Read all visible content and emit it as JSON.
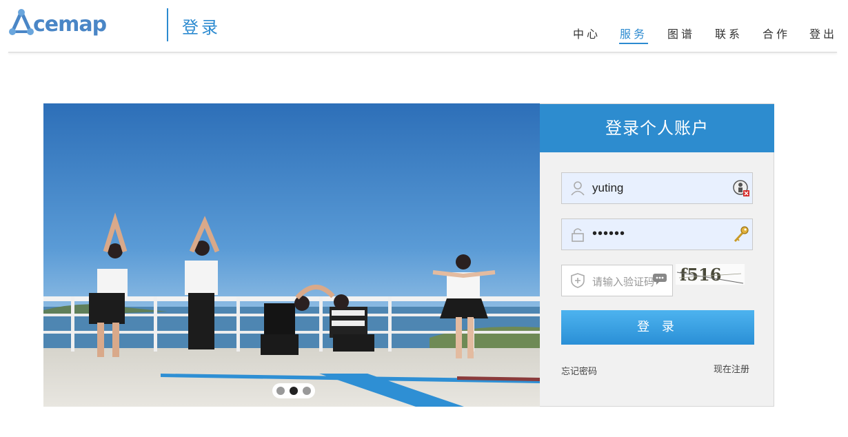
{
  "header": {
    "logo_text": "cemap",
    "title": "登录",
    "nav": [
      {
        "label": "中心",
        "active": false
      },
      {
        "label": "服务",
        "active": true
      },
      {
        "label": "图谱",
        "active": false
      },
      {
        "label": "联系",
        "active": false
      },
      {
        "label": "合作",
        "active": false
      },
      {
        "label": "登出",
        "active": false
      }
    ]
  },
  "banner": {
    "slides": 3,
    "active_slide": 2
  },
  "login": {
    "heading": "登录个人账户",
    "username_value": "yuting",
    "password_value": "••••••",
    "captcha_placeholder": "请输入验证码",
    "captcha_text": "f516",
    "submit_label": "登 录",
    "forgot_label": "忘记密码",
    "register_label": "现在注册"
  },
  "colors": {
    "accent": "#2b8ad0",
    "panel_head": "#2d8ccf",
    "input_fill": "#e8f0fe"
  }
}
